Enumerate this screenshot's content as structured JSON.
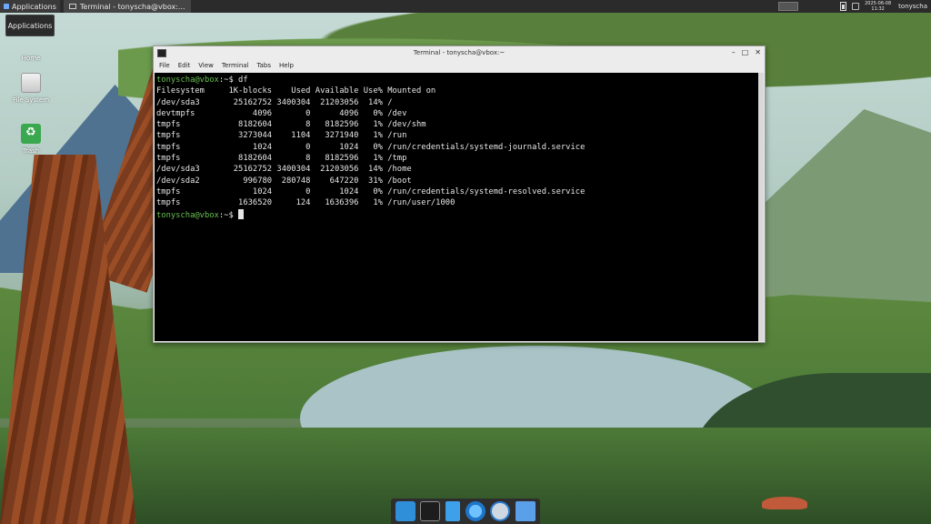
{
  "top_panel": {
    "applications_label": "Applications",
    "task_label": "Terminal - tonyscha@vbox:...",
    "clock_date": "2025-06-08",
    "clock_time": "11:32",
    "user": "tonyscha"
  },
  "tooltip": {
    "text": "Applications"
  },
  "desktop": {
    "icons": [
      {
        "label": "Home",
        "icon": "home-icon"
      },
      {
        "label": "File System",
        "icon": "drive-icon"
      },
      {
        "label": "Trash",
        "icon": "trash-icon"
      }
    ]
  },
  "terminal": {
    "title": "Terminal - tonyscha@vbox:~",
    "controls": {
      "minimize": "–",
      "maximize": "□",
      "close": "✕"
    },
    "menu": [
      "File",
      "Edit",
      "View",
      "Terminal",
      "Tabs",
      "Help"
    ],
    "prompt_user": "tonyscha@vbox",
    "prompt_suffix": ":~$ ",
    "command": "df",
    "output": [
      "Filesystem     1K-blocks    Used Available Use% Mounted on",
      "/dev/sda3       25162752 3400304  21203056  14% /",
      "devtmpfs            4096       0      4096   0% /dev",
      "tmpfs            8182604       8   8182596   1% /dev/shm",
      "tmpfs            3273044    1104   3271940   1% /run",
      "tmpfs               1024       0      1024   0% /run/credentials/systemd-journald.service",
      "tmpfs            8182604       8   8182596   1% /tmp",
      "/dev/sda3       25162752 3400304  21203056  14% /home",
      "/dev/sda2         996780  280748    647220  31% /boot",
      "tmpfs               1024       0      1024   0% /run/credentials/systemd-resolved.service",
      "tmpfs            1636520     124   1636396   1% /run/user/1000"
    ]
  },
  "dock": {
    "items": [
      "desktop-icon",
      "terminal-icon",
      "files-icon",
      "browser-icon",
      "search-icon",
      "folder-icon"
    ]
  },
  "colors": {
    "prompt": "#67c04f",
    "terminal_bg": "#000000",
    "panel_bg": "#2b2b2b"
  }
}
